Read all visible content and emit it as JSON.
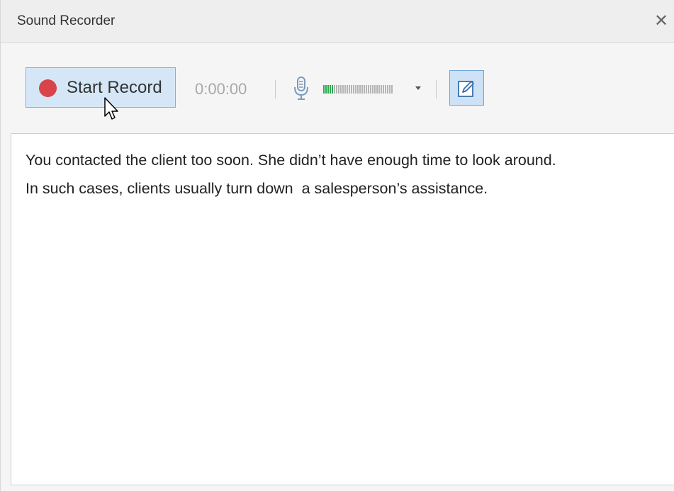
{
  "window": {
    "title": "Sound Recorder",
    "close_symbol": "✕"
  },
  "toolbar": {
    "record_label": "Start Record",
    "timer": "0:00:00",
    "mic_icon": "microphone-icon",
    "meter_level": 0.15,
    "record_color": "#d9434a",
    "meter_active_color": "#2fa84f"
  },
  "content": {
    "lines": [
      "You contacted the client too soon. She didn’t have enough time to look around.",
      "In such cases, clients usually turn down  a salesperson’s assistance."
    ]
  }
}
